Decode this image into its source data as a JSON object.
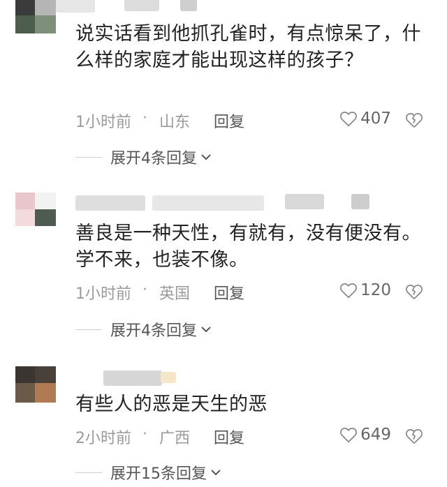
{
  "comments": [
    {
      "text": "说实话看到他抓孔雀时，有点惊呆了，什么样的家庭才能出现这样的孩子？",
      "time": "1小时前",
      "location": "山东",
      "reply_label": "回复",
      "likes": "407",
      "expand_label": "展开4条回复"
    },
    {
      "text": "善良是一种天性，有就有，没有便没有。学不来，也装不像。",
      "time": "1小时前",
      "location": "英国",
      "reply_label": "回复",
      "likes": "120",
      "expand_label": "展开4条回复"
    },
    {
      "text": "有些人的恶是天生的恶",
      "time": "2小时前",
      "location": "广西",
      "reply_label": "回复",
      "likes": "649",
      "expand_label": "展开15条回复"
    }
  ],
  "separator": "·",
  "colors": {
    "text": "#222222",
    "meta": "#9a9a9a",
    "icon": "#888888"
  },
  "icons": [
    "heart-icon",
    "broken-heart-icon",
    "chevron-down-icon"
  ]
}
